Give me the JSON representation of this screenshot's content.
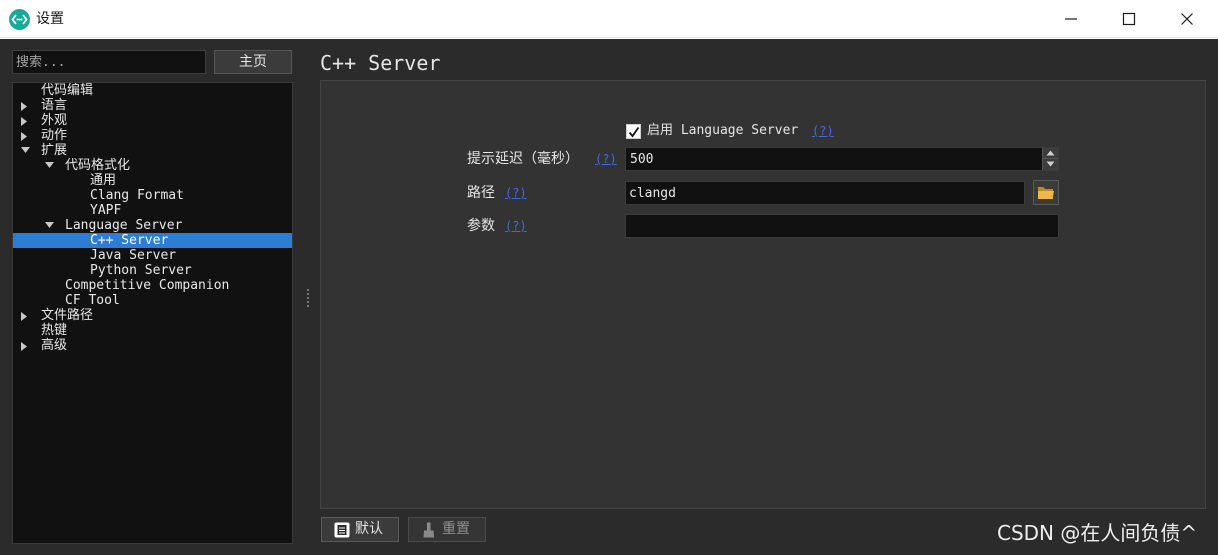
{
  "window": {
    "title": "设置",
    "app_icon": "code-brackets-icon",
    "controls": [
      "minimize-icon",
      "maximize-icon",
      "close-icon"
    ]
  },
  "sidebar": {
    "search_placeholder": "搜索...",
    "home_label": "主页",
    "tree": [
      {
        "label": "代码编辑",
        "level": 1,
        "arrow": "none",
        "selected": false
      },
      {
        "label": "语言",
        "level": 1,
        "arrow": "collapsed",
        "selected": false
      },
      {
        "label": "外观",
        "level": 1,
        "arrow": "collapsed",
        "selected": false
      },
      {
        "label": "动作",
        "level": 1,
        "arrow": "collapsed",
        "selected": false
      },
      {
        "label": "扩展",
        "level": 1,
        "arrow": "expanded",
        "selected": false
      },
      {
        "label": "代码格式化",
        "level": 2,
        "arrow": "expanded",
        "selected": false
      },
      {
        "label": "通用",
        "level": 3,
        "arrow": "none",
        "selected": false
      },
      {
        "label": "Clang Format",
        "level": 3,
        "arrow": "none",
        "selected": false
      },
      {
        "label": "YAPF",
        "level": 3,
        "arrow": "none",
        "selected": false
      },
      {
        "label": "Language Server",
        "level": 2,
        "arrow": "expanded",
        "selected": false
      },
      {
        "label": "C++ Server",
        "level": 3,
        "arrow": "none",
        "selected": true
      },
      {
        "label": "Java Server",
        "level": 3,
        "arrow": "none",
        "selected": false
      },
      {
        "label": "Python Server",
        "level": 3,
        "arrow": "none",
        "selected": false
      },
      {
        "label": "Competitive Companion",
        "level": 2,
        "arrow": "none",
        "selected": false
      },
      {
        "label": "CF Tool",
        "level": 2,
        "arrow": "none",
        "selected": false
      },
      {
        "label": "文件路径",
        "level": 1,
        "arrow": "collapsed",
        "selected": false
      },
      {
        "label": "热键",
        "level": 1,
        "arrow": "none",
        "selected": false
      },
      {
        "label": "高级",
        "level": 1,
        "arrow": "collapsed",
        "selected": false
      }
    ]
  },
  "page": {
    "title": "C++ Server",
    "enable": {
      "label": "启用 Language Server",
      "checked": true,
      "help": "(?)"
    },
    "delay": {
      "label": "提示延迟（毫秒）",
      "value": "500",
      "help": "(?)"
    },
    "path": {
      "label": "路径",
      "value": "clangd",
      "help": "(?)"
    },
    "args": {
      "label": "参数",
      "value": "",
      "help": "(?)"
    }
  },
  "footer": {
    "default_label": "默认",
    "reset_label": "重置",
    "reset_enabled": false
  },
  "watermark": "CSDN @在人间负债^",
  "colors": {
    "selection": "#2d7dd2",
    "link": "#3f6bdc",
    "app_icon": "#1aa89a",
    "background": "#2b2b2b"
  }
}
